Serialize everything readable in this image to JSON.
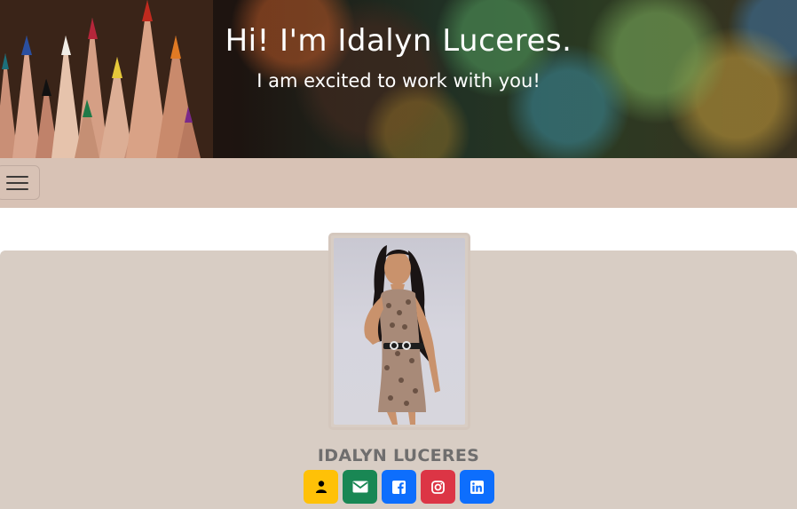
{
  "hero": {
    "title": "Hi! I'm Idalyn Luceres.",
    "subtitle": "I am excited to work with you!"
  },
  "navbar": {
    "toggle_icon": "hamburger-menu-icon",
    "background": "#d8c2b5"
  },
  "profile": {
    "name": "IDALYN LUCERES",
    "photo_alt": "Idalyn Luceres",
    "social_links": [
      {
        "icon": "person-icon",
        "color": "#ffc107"
      },
      {
        "icon": "envelope-icon",
        "color": "#198754"
      },
      {
        "icon": "facebook-icon",
        "color": "#0d6efd"
      },
      {
        "icon": "instagram-icon",
        "color": "#dc3545"
      },
      {
        "icon": "linkedin-icon",
        "color": "#0d6efd"
      }
    ]
  }
}
